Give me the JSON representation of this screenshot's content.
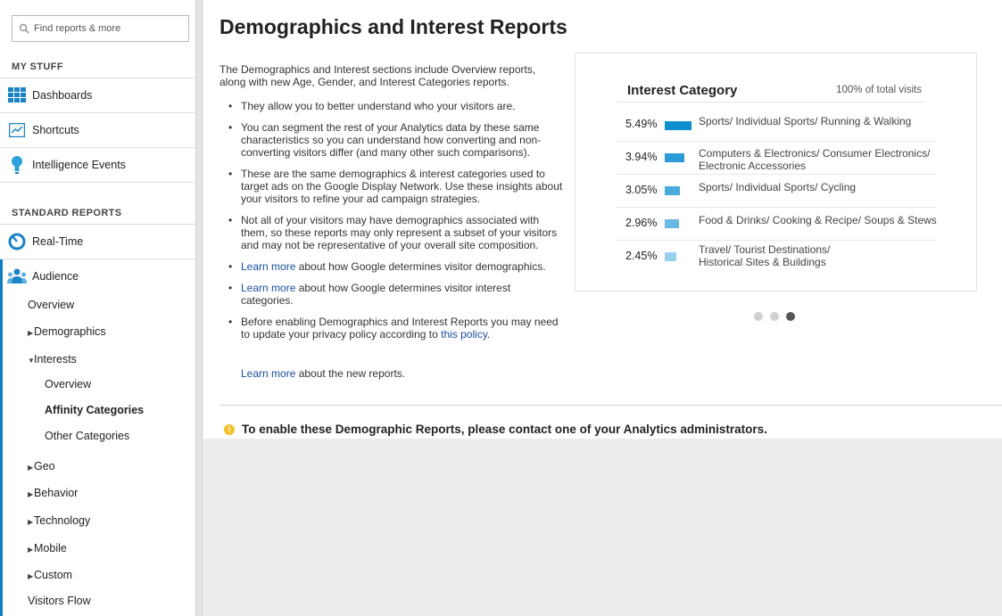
{
  "search": {
    "placeholder": "Find reports & more"
  },
  "my_stuff": {
    "title": "MY STUFF",
    "items": [
      {
        "label": "Dashboards",
        "icon": "dashboards-icon"
      },
      {
        "label": "Shortcuts",
        "icon": "shortcuts-icon"
      },
      {
        "label": "Intelligence Events",
        "icon": "lightbulb-icon"
      }
    ]
  },
  "standard_reports": {
    "title": "STANDARD REPORTS",
    "realtime": "Real-Time",
    "audience": "Audience",
    "sub": {
      "overview": "Overview",
      "demographics": "Demographics",
      "interests": "Interests",
      "interests_overview": "Overview",
      "affinity": "Affinity Categories",
      "other": "Other Categories",
      "geo": "Geo",
      "behavior": "Behavior",
      "technology": "Technology",
      "mobile": "Mobile",
      "custom": "Custom",
      "visitors_flow": "Visitors Flow"
    }
  },
  "main": {
    "title": "Demographics and Interest Reports",
    "intro": "The Demographics and Interest sections include Overview reports, along with new Age, Gender, and Interest Categories reports.",
    "bullets": {
      "b1": "They allow you to better understand who your visitors are.",
      "b2": "You can segment the rest of your Analytics data by these same characteristics so you can understand how converting and non-converting visitors differ (and many other such comparisons).",
      "b3": "These are the same demographics & interest categories used to target ads on the Google Display Network. Use these insights about your visitors to refine your ad campaign strategies.",
      "b4": "Not all of your visitors may have demographics associated with them, so these reports may only represent a subset of your visitors and may not be representative of your overall site composition.",
      "b5_link": "Learn more",
      "b5_text": " about how Google determines visitor demographics.",
      "b6_link": "Learn more",
      "b6_text": " about how Google determines visitor interest categories.",
      "b7_text": "Before enabling Demographics and Interest Reports you may need to update your privacy policy according to ",
      "b7_link": "this policy",
      "b7_end": "."
    },
    "learn_new_link": "Learn more",
    "learn_new_text": " about the new reports.",
    "notice": "To enable these Demographic Reports, please contact one of your Analytics administrators."
  },
  "card": {
    "title": "Interest Category",
    "subtitle": "100% of total visits",
    "rows": [
      {
        "pct": "5.49%",
        "value": 5.49,
        "label": "Sports/ Individual Sports/ Running & Walking",
        "color": "#0f8ecf"
      },
      {
        "pct": "3.94%",
        "value": 3.94,
        "label": "Computers & Electronics/ Consumer Electronics/ Electronic Accessories",
        "color": "#2b9ad6"
      },
      {
        "pct": "3.05%",
        "value": 3.05,
        "label": "Sports/ Individual Sports/ Cycling",
        "color": "#4aaadc"
      },
      {
        "pct": "2.96%",
        "value": 2.96,
        "label": "Food & Drinks/ Cooking & Recipe/ Soups & Stews",
        "color": "#6ab9e2"
      },
      {
        "pct": "2.45%",
        "value": 2.45,
        "label": "Travel/ Tourist Destinations/ Historical Sites & Buildings",
        "color": "#98cfec"
      }
    ],
    "carousel": {
      "count": 3,
      "active": 3
    }
  }
}
